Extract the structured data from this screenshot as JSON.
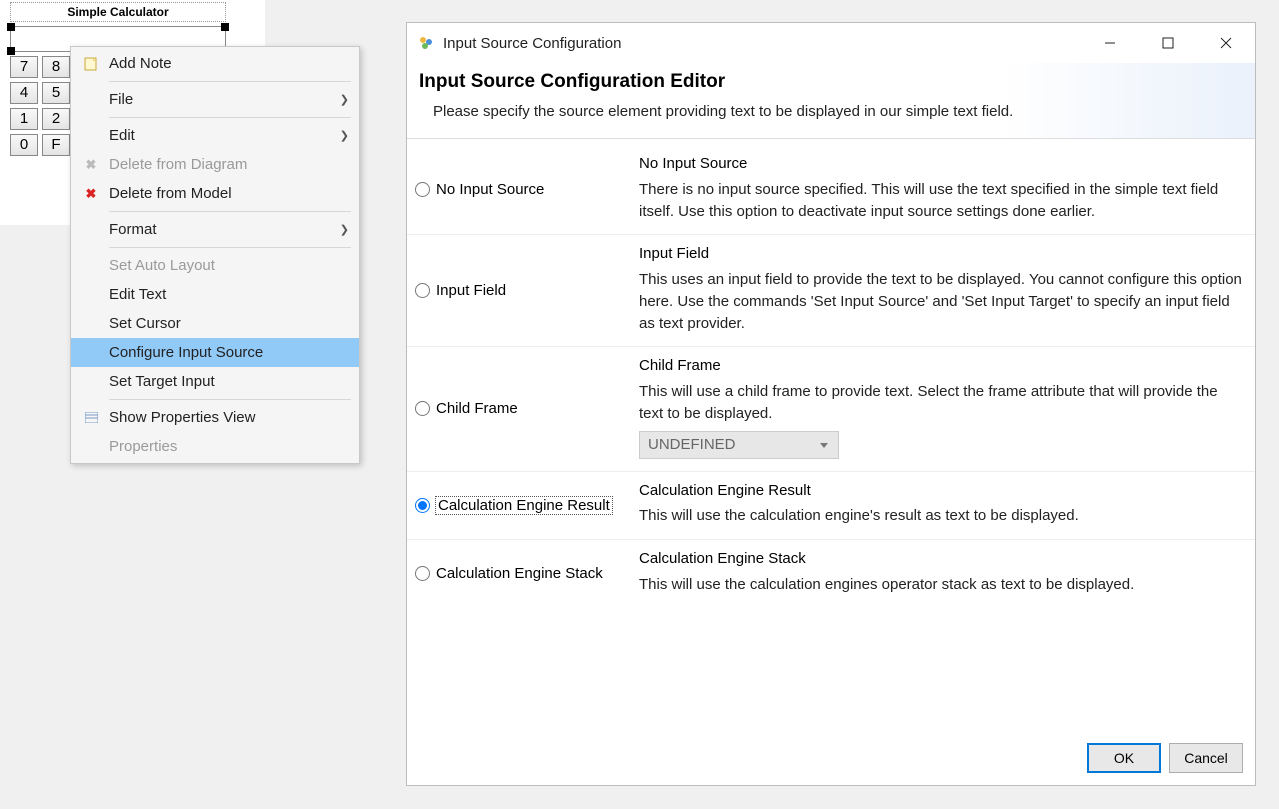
{
  "calculator": {
    "title": "Simple Calculator",
    "buttons": [
      "7",
      "8",
      "4",
      "5",
      "1",
      "2",
      "0",
      "F"
    ]
  },
  "context_menu": {
    "items": [
      {
        "label": "Add Note",
        "icon": "note",
        "submenu": false,
        "disabled": false
      },
      {
        "sep": true
      },
      {
        "label": "File",
        "submenu": true,
        "disabled": false
      },
      {
        "sep": true
      },
      {
        "label": "Edit",
        "submenu": true,
        "disabled": false
      },
      {
        "label": "Delete from Diagram",
        "icon": "x-gray",
        "disabled": true
      },
      {
        "label": "Delete from Model",
        "icon": "x-red",
        "disabled": false
      },
      {
        "sep": true
      },
      {
        "label": "Format",
        "submenu": true,
        "disabled": false
      },
      {
        "sep": true
      },
      {
        "label": "Set Auto Layout",
        "disabled": true
      },
      {
        "label": "Edit Text",
        "disabled": false
      },
      {
        "label": "Set Cursor",
        "disabled": false
      },
      {
        "label": "Configure Input Source",
        "disabled": false,
        "highlight": true
      },
      {
        "label": "Set Target Input",
        "disabled": false
      },
      {
        "sep": true
      },
      {
        "label": "Show Properties View",
        "icon": "props",
        "disabled": false
      },
      {
        "label": "Properties",
        "disabled": true
      }
    ]
  },
  "dialog": {
    "window_title": "Input Source Configuration",
    "header_title": "Input Source Configuration Editor",
    "header_desc": "Please specify the source element providing text to be displayed in our simple text field.",
    "options": [
      {
        "radio_label": "No Input Source",
        "desc_title": "No Input Source",
        "desc_body": "There is no input source specified. This will use the text specified in the simple text field itself. Use this option to deactivate input source settings done earlier.",
        "selected": false
      },
      {
        "radio_label": "Input Field",
        "desc_title": "Input Field",
        "desc_body": "This uses an input field to provide the text to be displayed. You cannot configure this option here. Use the commands 'Set Input Source' and 'Set Input Target' to specify an input field as text provider.",
        "selected": false
      },
      {
        "radio_label": "Child Frame",
        "desc_title": "Child Frame",
        "desc_body": "This will use a child frame to provide text. Select the frame attribute that will provide the text to be displayed.",
        "selected": false,
        "combo": "UNDEFINED"
      },
      {
        "radio_label": "Calculation Engine Result",
        "desc_title": "Calculation Engine Result",
        "desc_body": "This will use the calculation engine's result as text to be displayed.",
        "selected": true
      },
      {
        "radio_label": "Calculation Engine Stack",
        "desc_title": "Calculation Engine Stack",
        "desc_body": "This will use the calculation engines operator stack as text to be displayed.",
        "selected": false
      }
    ],
    "ok_label": "OK",
    "cancel_label": "Cancel"
  }
}
